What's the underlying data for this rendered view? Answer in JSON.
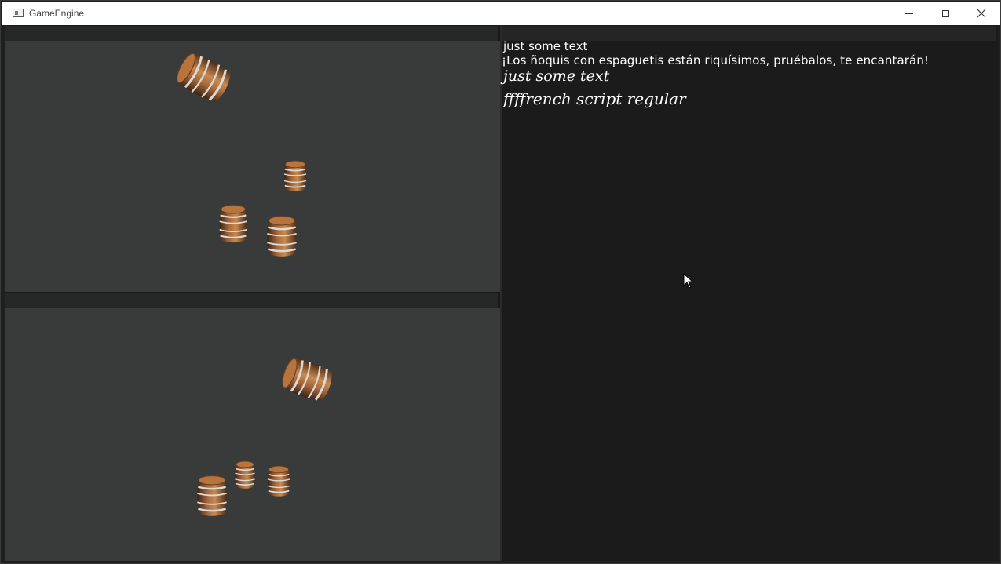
{
  "window": {
    "title": "GameEngine",
    "controls": {
      "minimize": "minimize-icon",
      "maximize": "maximize-icon",
      "close": "close-icon"
    }
  },
  "viewports": [
    {
      "name": "top-viewport",
      "objects": [
        "barrel",
        "barrel",
        "barrel",
        "barrel"
      ]
    },
    {
      "name": "bottom-viewport",
      "objects": [
        "barrel",
        "barrel",
        "barrel",
        "barrel"
      ]
    }
  ],
  "text_panel": {
    "lines": [
      "just some text",
      "¡Los ñoquis con espaguetis están riquísimos, pruébalos, te encantarán!",
      "just some text",
      "ffffrench script regular"
    ]
  },
  "colors": {
    "viewport_bg": "#393b3b",
    "panel_bg": "#1b1b1b",
    "text": "#ffffff",
    "barrel_wood": "#b8743e",
    "barrel_hoop": "#d7d7d7"
  },
  "icons": {
    "cursor": "cursor-arrow-icon",
    "app": "app-icon"
  }
}
